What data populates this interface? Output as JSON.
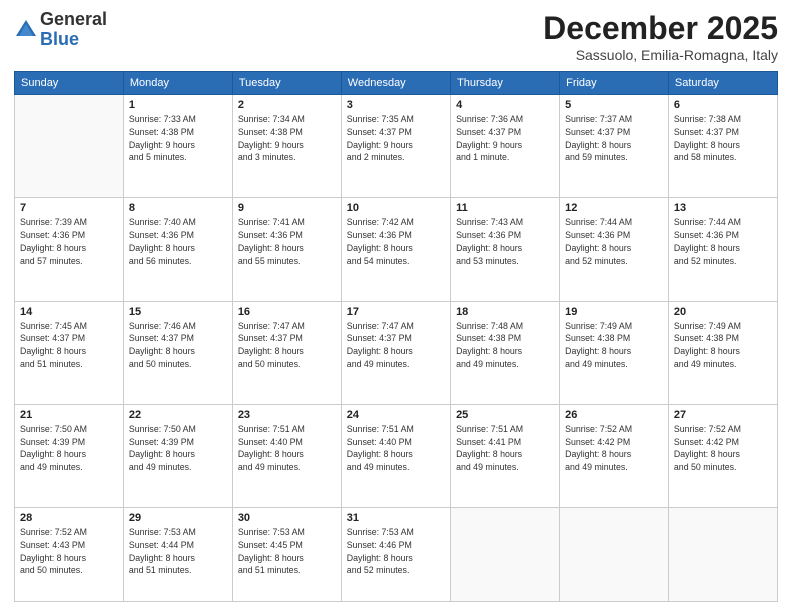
{
  "header": {
    "logo_line1": "General",
    "logo_line2": "Blue",
    "month": "December 2025",
    "location": "Sassuolo, Emilia-Romagna, Italy"
  },
  "weekdays": [
    "Sunday",
    "Monday",
    "Tuesday",
    "Wednesday",
    "Thursday",
    "Friday",
    "Saturday"
  ],
  "weeks": [
    [
      {
        "day": "",
        "info": ""
      },
      {
        "day": "1",
        "info": "Sunrise: 7:33 AM\nSunset: 4:38 PM\nDaylight: 9 hours\nand 5 minutes."
      },
      {
        "day": "2",
        "info": "Sunrise: 7:34 AM\nSunset: 4:38 PM\nDaylight: 9 hours\nand 3 minutes."
      },
      {
        "day": "3",
        "info": "Sunrise: 7:35 AM\nSunset: 4:37 PM\nDaylight: 9 hours\nand 2 minutes."
      },
      {
        "day": "4",
        "info": "Sunrise: 7:36 AM\nSunset: 4:37 PM\nDaylight: 9 hours\nand 1 minute."
      },
      {
        "day": "5",
        "info": "Sunrise: 7:37 AM\nSunset: 4:37 PM\nDaylight: 8 hours\nand 59 minutes."
      },
      {
        "day": "6",
        "info": "Sunrise: 7:38 AM\nSunset: 4:37 PM\nDaylight: 8 hours\nand 58 minutes."
      }
    ],
    [
      {
        "day": "7",
        "info": "Sunrise: 7:39 AM\nSunset: 4:36 PM\nDaylight: 8 hours\nand 57 minutes."
      },
      {
        "day": "8",
        "info": "Sunrise: 7:40 AM\nSunset: 4:36 PM\nDaylight: 8 hours\nand 56 minutes."
      },
      {
        "day": "9",
        "info": "Sunrise: 7:41 AM\nSunset: 4:36 PM\nDaylight: 8 hours\nand 55 minutes."
      },
      {
        "day": "10",
        "info": "Sunrise: 7:42 AM\nSunset: 4:36 PM\nDaylight: 8 hours\nand 54 minutes."
      },
      {
        "day": "11",
        "info": "Sunrise: 7:43 AM\nSunset: 4:36 PM\nDaylight: 8 hours\nand 53 minutes."
      },
      {
        "day": "12",
        "info": "Sunrise: 7:44 AM\nSunset: 4:36 PM\nDaylight: 8 hours\nand 52 minutes."
      },
      {
        "day": "13",
        "info": "Sunrise: 7:44 AM\nSunset: 4:36 PM\nDaylight: 8 hours\nand 52 minutes."
      }
    ],
    [
      {
        "day": "14",
        "info": "Sunrise: 7:45 AM\nSunset: 4:37 PM\nDaylight: 8 hours\nand 51 minutes."
      },
      {
        "day": "15",
        "info": "Sunrise: 7:46 AM\nSunset: 4:37 PM\nDaylight: 8 hours\nand 50 minutes."
      },
      {
        "day": "16",
        "info": "Sunrise: 7:47 AM\nSunset: 4:37 PM\nDaylight: 8 hours\nand 50 minutes."
      },
      {
        "day": "17",
        "info": "Sunrise: 7:47 AM\nSunset: 4:37 PM\nDaylight: 8 hours\nand 49 minutes."
      },
      {
        "day": "18",
        "info": "Sunrise: 7:48 AM\nSunset: 4:38 PM\nDaylight: 8 hours\nand 49 minutes."
      },
      {
        "day": "19",
        "info": "Sunrise: 7:49 AM\nSunset: 4:38 PM\nDaylight: 8 hours\nand 49 minutes."
      },
      {
        "day": "20",
        "info": "Sunrise: 7:49 AM\nSunset: 4:38 PM\nDaylight: 8 hours\nand 49 minutes."
      }
    ],
    [
      {
        "day": "21",
        "info": "Sunrise: 7:50 AM\nSunset: 4:39 PM\nDaylight: 8 hours\nand 49 minutes."
      },
      {
        "day": "22",
        "info": "Sunrise: 7:50 AM\nSunset: 4:39 PM\nDaylight: 8 hours\nand 49 minutes."
      },
      {
        "day": "23",
        "info": "Sunrise: 7:51 AM\nSunset: 4:40 PM\nDaylight: 8 hours\nand 49 minutes."
      },
      {
        "day": "24",
        "info": "Sunrise: 7:51 AM\nSunset: 4:40 PM\nDaylight: 8 hours\nand 49 minutes."
      },
      {
        "day": "25",
        "info": "Sunrise: 7:51 AM\nSunset: 4:41 PM\nDaylight: 8 hours\nand 49 minutes."
      },
      {
        "day": "26",
        "info": "Sunrise: 7:52 AM\nSunset: 4:42 PM\nDaylight: 8 hours\nand 49 minutes."
      },
      {
        "day": "27",
        "info": "Sunrise: 7:52 AM\nSunset: 4:42 PM\nDaylight: 8 hours\nand 50 minutes."
      }
    ],
    [
      {
        "day": "28",
        "info": "Sunrise: 7:52 AM\nSunset: 4:43 PM\nDaylight: 8 hours\nand 50 minutes."
      },
      {
        "day": "29",
        "info": "Sunrise: 7:53 AM\nSunset: 4:44 PM\nDaylight: 8 hours\nand 51 minutes."
      },
      {
        "day": "30",
        "info": "Sunrise: 7:53 AM\nSunset: 4:45 PM\nDaylight: 8 hours\nand 51 minutes."
      },
      {
        "day": "31",
        "info": "Sunrise: 7:53 AM\nSunset: 4:46 PM\nDaylight: 8 hours\nand 52 minutes."
      },
      {
        "day": "",
        "info": ""
      },
      {
        "day": "",
        "info": ""
      },
      {
        "day": "",
        "info": ""
      }
    ]
  ]
}
